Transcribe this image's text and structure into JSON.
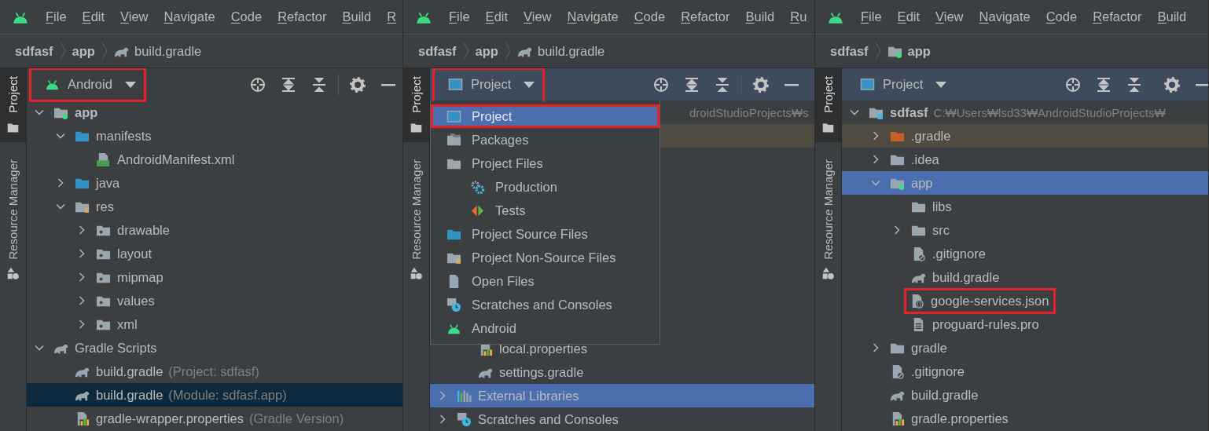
{
  "panels": [
    {
      "focused": false,
      "menu_bar": [
        "File",
        "Edit",
        "View",
        "Navigate",
        "Code",
        "Refactor",
        "Build",
        "R"
      ],
      "breadcrumbs": [
        {
          "label": "sdfasf",
          "kind": "directory"
        },
        {
          "label": "app",
          "kind": "directory"
        },
        {
          "label": "build.gradle",
          "kind": "gradle"
        }
      ],
      "side_tabs": [
        {
          "label": "Project",
          "selected": true
        },
        {
          "label": "Resource Manager",
          "selected": false
        }
      ],
      "selector": {
        "label": "Android",
        "kind": "android",
        "highlighted": true
      },
      "tree": [
        {
          "label": "app",
          "bold": true,
          "kind": "module",
          "expanded": true,
          "selected": false,
          "children": [
            {
              "label": "manifests",
              "kind": "folder-blue",
              "expanded": true,
              "selected": false,
              "children": [
                {
                  "label": "AndroidManifest.xml",
                  "kind": "manifest",
                  "selected": false
                }
              ]
            },
            {
              "label": "java",
              "kind": "folder-blue",
              "expanded": false,
              "selected": false
            },
            {
              "label": "res",
              "kind": "res",
              "expanded": true,
              "selected": false,
              "children": [
                {
                  "label": "drawable",
                  "kind": "res-sub",
                  "expanded": false,
                  "selected": false
                },
                {
                  "label": "layout",
                  "kind": "res-sub",
                  "expanded": false,
                  "selected": false
                },
                {
                  "label": "mipmap",
                  "kind": "res-sub",
                  "expanded": false,
                  "selected": false
                },
                {
                  "label": "values",
                  "kind": "res-sub",
                  "expanded": false,
                  "selected": false
                },
                {
                  "label": "xml",
                  "kind": "res-sub",
                  "expanded": false,
                  "selected": false
                }
              ]
            }
          ]
        },
        {
          "label": "Gradle Scripts",
          "kind": "gradle",
          "expanded": true,
          "selected": false,
          "children": [
            {
              "label": "build.gradle",
              "note": "(Project: sdfasf)",
              "kind": "gradle",
              "selected": false
            },
            {
              "label": "build.gradle",
              "note": "(Module: sdfasf.app)",
              "kind": "gradle",
              "selected": true
            },
            {
              "label": "gradle-wrapper.properties",
              "note": "(Gradle Version)",
              "kind": "properties",
              "selected": false
            }
          ]
        }
      ]
    },
    {
      "focused": true,
      "menu_bar": [
        "File",
        "Edit",
        "View",
        "Navigate",
        "Code",
        "Refactor",
        "Build",
        "Ru"
      ],
      "breadcrumbs": [
        {
          "label": "sdfasf",
          "kind": "directory"
        },
        {
          "label": "app",
          "kind": "directory"
        },
        {
          "label": "build.gradle",
          "kind": "gradle"
        }
      ],
      "side_tabs": [
        {
          "label": "Project",
          "selected": true
        },
        {
          "label": "Resource Manager",
          "selected": false
        }
      ],
      "selector": {
        "label": "Project",
        "kind": "window",
        "highlighted": true
      },
      "menu": [
        {
          "label": "Project",
          "kind": "window",
          "selected": true,
          "highlighted": true
        },
        {
          "label": "Packages",
          "kind": "packages",
          "selected": false
        },
        {
          "label": "Project Files",
          "kind": "folder",
          "selected": false,
          "children": [
            {
              "label": "Production",
              "kind": "production",
              "selected": false
            },
            {
              "label": "Tests",
              "kind": "tests",
              "selected": false
            }
          ]
        },
        {
          "label": "Project Source Files",
          "kind": "folder-blue",
          "selected": false
        },
        {
          "label": "Project Non-Source Files",
          "kind": "res",
          "selected": false
        },
        {
          "label": "Open Files",
          "kind": "open-files",
          "selected": false
        },
        {
          "label": "Scratches and Consoles",
          "kind": "scratches",
          "selected": false
        },
        {
          "label": "Android",
          "kind": "android",
          "selected": false
        }
      ],
      "tree": [
        {
          "path": "droidStudioProjects₩s",
          "selected": false,
          "children": [
            {
              "excluded": true,
              "selected": false
            },
            {
              "label": "local.properties",
              "kind": "properties",
              "selected": false
            },
            {
              "label": "settings.gradle",
              "kind": "gradle",
              "selected": false
            }
          ]
        },
        {
          "label": "External Libraries",
          "kind": "libraries",
          "expanded": false,
          "selected": true
        },
        {
          "label": "Scratches and Consoles",
          "kind": "scratches",
          "expanded": false,
          "selected": false
        }
      ]
    },
    {
      "focused": true,
      "menu_bar": [
        "File",
        "Edit",
        "View",
        "Navigate",
        "Code",
        "Refactor",
        "Build"
      ],
      "breadcrumbs": [
        {
          "label": "sdfasf",
          "kind": "directory"
        },
        {
          "label": "app",
          "kind": "module"
        }
      ],
      "side_tabs": [
        {
          "label": "Project",
          "selected": true
        },
        {
          "label": "Resource Manager",
          "selected": false
        }
      ],
      "selector": {
        "label": "Project",
        "kind": "window",
        "highlighted": false
      },
      "tree": [
        {
          "label": "sdfasf",
          "bold": true,
          "path": "C:₩Users₩lsd33₩AndroidStudioProjects₩",
          "kind": "root",
          "expanded": true,
          "selected": false,
          "children": [
            {
              "label": ".gradle",
              "kind": "folder-orange",
              "expanded": false,
              "excluded": true,
              "selected": false
            },
            {
              "label": ".idea",
              "kind": "folder",
              "expanded": false,
              "selected": false
            },
            {
              "label": "app",
              "kind": "module",
              "expanded": true,
              "selected": true,
              "children": [
                {
                  "label": "libs",
                  "kind": "folder",
                  "selected": false
                },
                {
                  "label": "src",
                  "kind": "folder",
                  "expanded": false,
                  "selected": false
                },
                {
                  "label": ".gitignore",
                  "kind": "gitignore",
                  "selected": false
                },
                {
                  "label": "build.gradle",
                  "kind": "gradle",
                  "selected": false
                },
                {
                  "label": "google-services.json",
                  "kind": "json",
                  "highlighted": true,
                  "selected": false
                },
                {
                  "label": "proguard-rules.pro",
                  "kind": "text",
                  "selected": false
                }
              ]
            },
            {
              "label": "gradle",
              "kind": "folder",
              "expanded": false,
              "selected": false
            },
            {
              "label": ".gitignore",
              "kind": "gitignore",
              "selected": false
            },
            {
              "label": "build.gradle",
              "kind": "gradle",
              "selected": false
            },
            {
              "label": "gradle.properties",
              "kind": "properties",
              "selected": false
            }
          ]
        }
      ]
    }
  ]
}
